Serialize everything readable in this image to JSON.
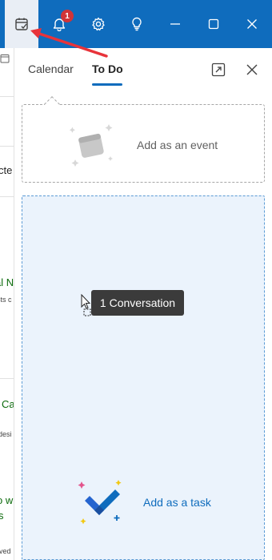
{
  "titlebar": {
    "notification_count": "1",
    "icons": [
      "calendar-check-icon",
      "bell-icon",
      "gear-icon",
      "lightbulb-icon",
      "minimize-icon",
      "maximize-icon",
      "close-icon"
    ]
  },
  "background_list": {
    "fragments": [
      "cte",
      "al N",
      "sts c",
      "Ca",
      "desi",
      "o wi",
      "s",
      "rved"
    ]
  },
  "pane": {
    "tabs": [
      {
        "label": "Calendar",
        "active": false
      },
      {
        "label": "To Do",
        "active": true
      }
    ],
    "event_drop_label": "Add as an event",
    "task_drop_label": "Add as a task"
  },
  "drag": {
    "tooltip": "1 Conversation"
  },
  "colors": {
    "titlebar": "#0f6cbd",
    "accent": "#0f6cbd",
    "badge": "#d13438",
    "task_zone_bg": "#ebf3fc",
    "annotation_arrow": "#e8333a"
  }
}
